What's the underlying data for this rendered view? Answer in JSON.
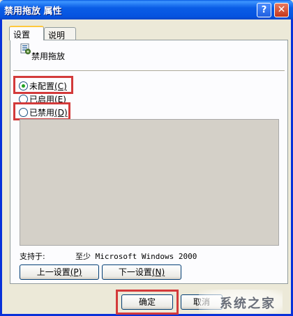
{
  "window": {
    "title": "禁用拖放 属性",
    "help_glyph": "?",
    "close_glyph": "✕"
  },
  "tabs": [
    {
      "label": "设置",
      "active": true
    },
    {
      "label": "说明",
      "active": false
    }
  ],
  "policy": {
    "name": "禁用拖放",
    "icon": "policy-icon"
  },
  "options": [
    {
      "label": "未配置",
      "key": "(C)",
      "selected": true
    },
    {
      "label": "已启用",
      "key": "(E)",
      "selected": false
    },
    {
      "label": "已禁用",
      "key": "(D)",
      "selected": false
    }
  ],
  "supported": {
    "label": "支持于:",
    "value": "至少 Microsoft Windows 2000"
  },
  "nav": {
    "prev_label": "上一设置",
    "prev_key": "(P)",
    "next_label": "下一设置",
    "next_key": "(N)"
  },
  "footer": {
    "ok_label": "确定",
    "cancel_label": "取消"
  },
  "colors": {
    "highlight_box": "#d33a3a",
    "titlebar": "#0553e0",
    "radio_selected": "#21a121"
  },
  "watermark": {
    "text": "系统之家"
  }
}
